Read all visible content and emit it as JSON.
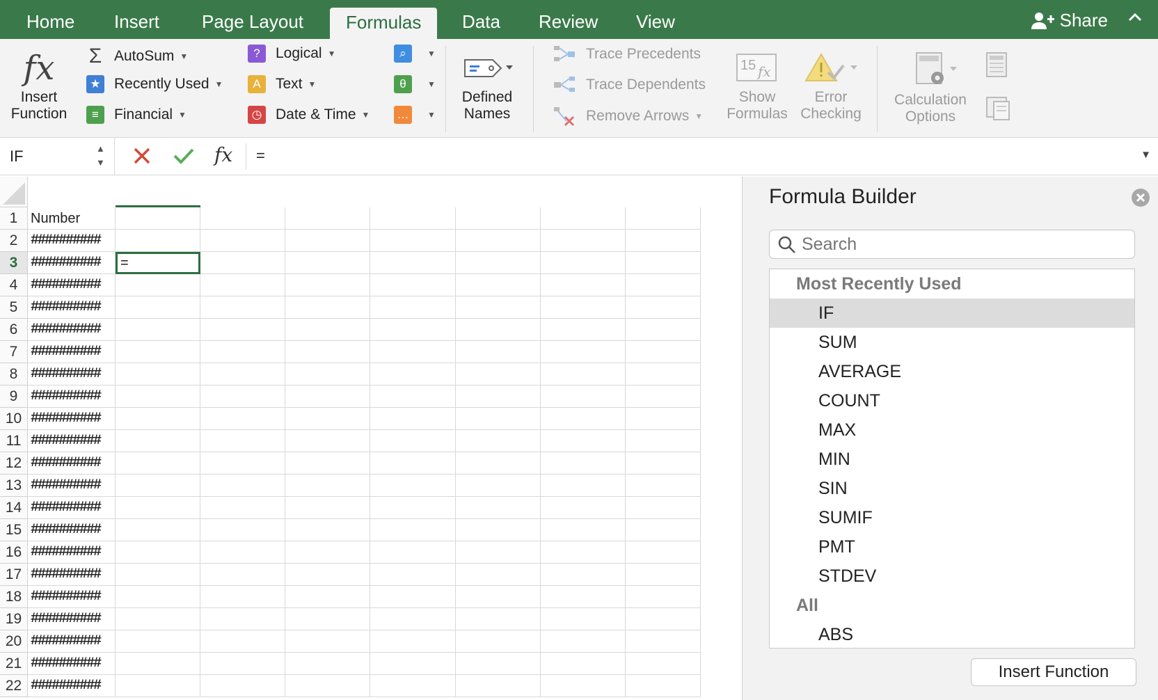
{
  "tabs": [
    "Home",
    "Insert",
    "Page Layout",
    "Formulas",
    "Data",
    "Review",
    "View"
  ],
  "share_label": "Share",
  "ribbon": {
    "insert_function": [
      "Insert",
      "Function"
    ],
    "autosum": "AutoSum",
    "recently_used": "Recently Used",
    "financial": "Financial",
    "logical": "Logical",
    "text": "Text",
    "date_time": "Date & Time",
    "defined_names": [
      "Defined",
      "Names"
    ],
    "trace_precedents": "Trace Precedents",
    "trace_dependents": "Trace Dependents",
    "remove_arrows": "Remove Arrows",
    "show_formulas": [
      "Show",
      "Formulas"
    ],
    "error_checking": [
      "Error",
      "Checking"
    ],
    "calculation_options": [
      "Calculation",
      "Options"
    ]
  },
  "formula_bar": {
    "name_box": "IF",
    "formula": "="
  },
  "sheet": {
    "rows": [
      "1",
      "2",
      "3",
      "4",
      "5",
      "6",
      "7",
      "8",
      "9",
      "10",
      "11",
      "12",
      "13",
      "14",
      "15",
      "16",
      "17",
      "18",
      "19",
      "20",
      "21",
      "22"
    ],
    "col_a_header": "Number",
    "col_a_value": "##########",
    "active_cell_value": "=",
    "active_row": "3"
  },
  "formula_builder": {
    "title": "Formula Builder",
    "search_placeholder": "Search",
    "section_recent": "Most Recently Used",
    "recent": [
      "IF",
      "SUM",
      "AVERAGE",
      "COUNT",
      "MAX",
      "MIN",
      "SIN",
      "SUMIF",
      "PMT",
      "STDEV"
    ],
    "section_all": "All",
    "all": [
      "ABS"
    ],
    "insert_button": "Insert Function"
  },
  "colors": {
    "accent": "#3a7a4a",
    "active_tab_text": "#2c6e40"
  }
}
